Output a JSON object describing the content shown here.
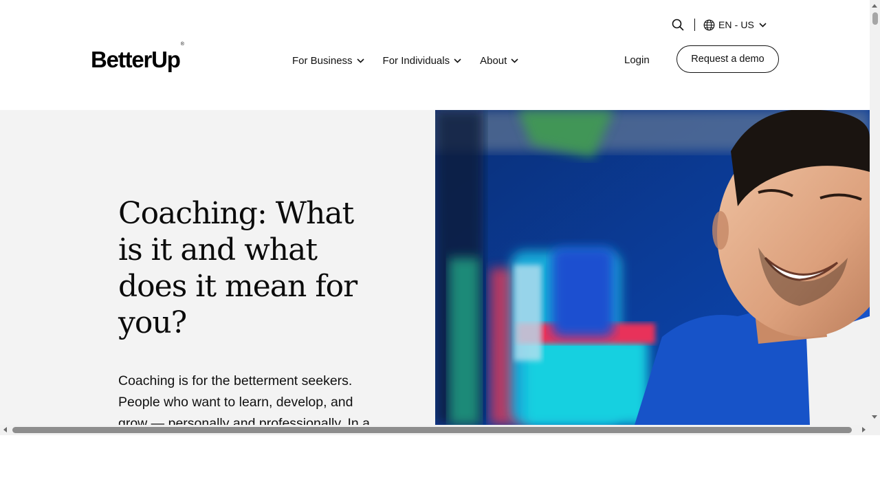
{
  "header": {
    "logo_text": "BetterUp",
    "logo_mark": "®",
    "utility": {
      "search_icon": "search-icon",
      "language_icon": "globe-icon",
      "language_label": "EN - US"
    },
    "nav": [
      {
        "label": "For Business",
        "icon": "chevron-down-icon"
      },
      {
        "label": "For Individuals",
        "icon": "chevron-down-icon"
      },
      {
        "label": "About",
        "icon": "chevron-down-icon"
      }
    ],
    "login_label": "Login",
    "demo_button_label": "Request a demo"
  },
  "hero": {
    "title": "Coaching: What is it and what does it mean for you?",
    "body": "Coaching is for the betterment seekers. People who want to learn, develop, and grow — personally and professionally. In a"
  },
  "colors": {
    "hero_left_bg": "#f3f3f3",
    "text": "#111111",
    "photo_blue": "#0d3a8c"
  }
}
